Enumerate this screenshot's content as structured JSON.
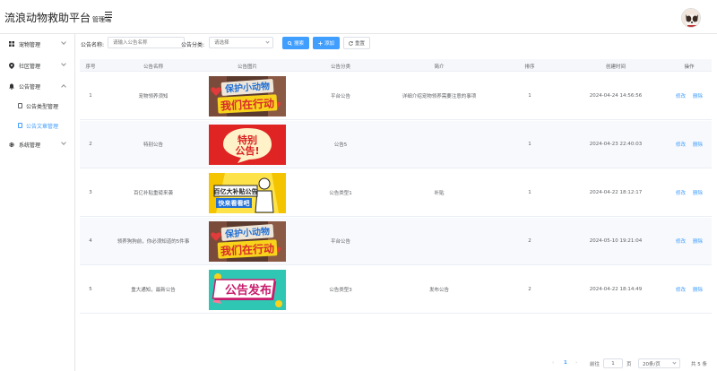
{
  "header": {
    "title": "流浪动物救助平台",
    "subtitle": "管理端"
  },
  "sidebar": {
    "items": [
      {
        "label": "宠物管理",
        "icon": "grid-icon",
        "expanded": false
      },
      {
        "label": "社区管理",
        "icon": "location-icon",
        "expanded": false
      },
      {
        "label": "公告管理",
        "icon": "bell-icon",
        "expanded": true,
        "children": [
          {
            "label": "公告类型管理",
            "icon": "edit-icon",
            "active": false
          },
          {
            "label": "公告文章管理",
            "icon": "document-icon",
            "active": true
          }
        ]
      },
      {
        "label": "系统管理",
        "icon": "gear-icon",
        "expanded": false
      }
    ]
  },
  "toolbar": {
    "name_label": "公告名称:",
    "name_placeholder": "请输入公告名称",
    "category_label": "公告分类:",
    "category_placeholder": "请选择",
    "search_label": "搜索",
    "add_label": "添加",
    "reset_label": "重置"
  },
  "table": {
    "headers": [
      "序号",
      "公告名称",
      "公告图片",
      "公告分类",
      "简介",
      "排序",
      "创建时间",
      "操作"
    ],
    "rows": [
      {
        "index": "1",
        "name": "宠物领养须知",
        "image": "banner-rescue",
        "category": "平台公告",
        "intro": "详细介绍宠物领养需要注意的事项",
        "sort": "1",
        "created": "2024-04-24 14:56:56"
      },
      {
        "index": "2",
        "name": "特别公告",
        "image": "banner-special",
        "category": "公告5",
        "intro": "",
        "sort": "1",
        "created": "2024-04-23 22:40:03"
      },
      {
        "index": "3",
        "name": "百亿补贴重磅来袭",
        "image": "banner-subsidy",
        "category": "公告类型1",
        "intro": "补贴",
        "sort": "1",
        "created": "2024-04-22 18:12:17"
      },
      {
        "index": "4",
        "name": "领养狗狗前，你必须知道的5件事",
        "image": "banner-rescue",
        "category": "平台公告",
        "intro": "",
        "sort": "2",
        "created": "2024-05-10 19:21:04"
      },
      {
        "index": "5",
        "name": "重大通知，最新公告",
        "image": "banner-release",
        "category": "公告类型3",
        "intro": "发布公告",
        "sort": "2",
        "created": "2024-04-22 18:14:49"
      }
    ],
    "edit_label": "修改",
    "delete_label": "删除"
  },
  "images": {
    "rescue_text1": "保护小动物",
    "rescue_text2": "我们在行动",
    "special_text1": "特别",
    "special_text2": "公告!",
    "subsidy_text1": "百亿大补贴公告",
    "subsidy_text2": "快来看看吧",
    "release_text": "公告发布"
  },
  "pagination": {
    "current_page": "1",
    "goto_label": "前往",
    "goto_value": "1",
    "page_unit": "页",
    "page_size": "20条/页",
    "total": "共 5 条"
  },
  "colors": {
    "primary": "#409eff",
    "header_bg": "#f5f7fa"
  }
}
